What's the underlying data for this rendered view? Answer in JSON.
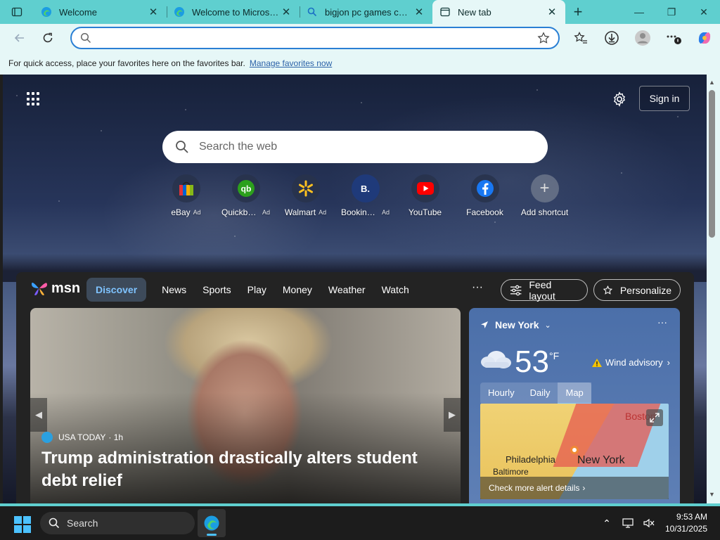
{
  "tabs": [
    {
      "title": "Welcome",
      "icon": "edge-icon"
    },
    {
      "title": "Welcome to Microsoft Edge",
      "icon": "edge-icon"
    },
    {
      "title": "bigjon pc games collection",
      "icon": "search-icon"
    },
    {
      "title": "New tab",
      "icon": "newtab-icon",
      "active": true
    }
  ],
  "address": {
    "value": "",
    "placeholder": ""
  },
  "favorites_bar": {
    "message": "For quick access, place your favorites here on the favorites bar.",
    "link": "Manage favorites now"
  },
  "page": {
    "signin_label": "Sign in",
    "search_placeholder": "Search the web",
    "shortcuts": [
      {
        "label": "eBay",
        "ad": "Ad",
        "icon": "ebay-icon"
      },
      {
        "label": "Quickbooks",
        "ad": "Ad",
        "icon": "quickbooks-icon"
      },
      {
        "label": "Walmart",
        "ad": "Ad",
        "icon": "walmart-icon"
      },
      {
        "label": "Booking.com",
        "ad": "Ad",
        "icon": "booking-icon"
      },
      {
        "label": "YouTube",
        "ad": "",
        "icon": "youtube-icon"
      },
      {
        "label": "Facebook",
        "ad": "",
        "icon": "facebook-icon"
      },
      {
        "label": "Add shortcut",
        "ad": "",
        "icon": "plus-icon"
      }
    ]
  },
  "feed": {
    "logo": "msn",
    "nav": [
      "Discover",
      "News",
      "Sports",
      "Play",
      "Money",
      "Weather",
      "Watch"
    ],
    "more": "···",
    "feed_layout": "Feed layout",
    "personalize": "Personalize",
    "hero": {
      "source": "USA TODAY",
      "age": "· 1h",
      "title": "Trump administration drastically alters student debt relief"
    },
    "weather": {
      "location": "New York",
      "temperature": "53",
      "unit": "°F",
      "alert": "Wind advisory",
      "tabs": [
        "Hourly",
        "Daily",
        "Map"
      ],
      "active_tab": "Map",
      "map_labels": [
        "Boston",
        "Philadelphia",
        "Baltimore",
        "New York"
      ],
      "check_alerts": "Check more alert details"
    }
  },
  "taskbar": {
    "search_label": "Search",
    "time": "9:53 AM",
    "date": "10/31/2025"
  },
  "colors": {
    "accent": "#5fcfcf",
    "chrome": "#e6f7f7",
    "link": "#2b62a8",
    "focus": "#2a7fd4"
  }
}
